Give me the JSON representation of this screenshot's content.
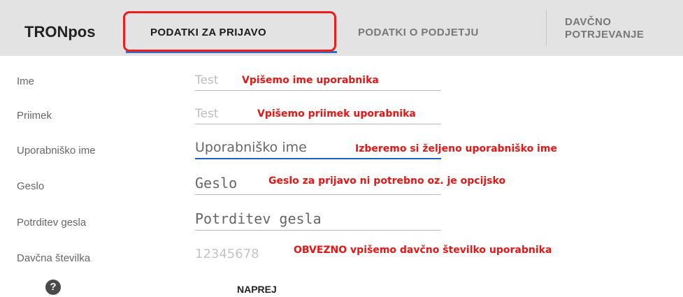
{
  "header": {
    "brand": "TRONpos",
    "tabs": [
      {
        "label": "PODATKI ZA PRIJAVO",
        "active": true
      },
      {
        "label": "PODATKI O PODJETJU",
        "active": false
      },
      {
        "label_line1": "DAVČNO",
        "label_line2": "POTRJEVANJE",
        "active": false
      }
    ]
  },
  "form": {
    "fields": [
      {
        "label": "Ime",
        "value": "Test",
        "note": "Vpišemo ime uporabnika"
      },
      {
        "label": "Priimek",
        "value": "Test",
        "note": "Vpišemo priimek uporabnika"
      },
      {
        "label": "Uporabniško ime",
        "value": "Uporabniško ime",
        "note": "Izberemo si željeno uporabniško ime"
      },
      {
        "label": "Geslo",
        "value": "Geslo",
        "note": "Geslo za prijavo ni potrebno oz. je opcijsko"
      },
      {
        "label": "Potrditev gesla",
        "value": "Potrditev gesla",
        "note": ""
      },
      {
        "label": "Davčna številka",
        "value": "12345678",
        "note": "OBVEZNO vpišemo davčno številko uporabnika"
      }
    ]
  },
  "footer": {
    "help_icon": "?",
    "next_label": "NAPREJ"
  },
  "colors": {
    "header_bg": "#e3e3e3",
    "highlight": "#ee1c1c",
    "accent": "#2a6fc9",
    "note": "#e81515"
  },
  "icons": [
    "question-circle-icon"
  ]
}
